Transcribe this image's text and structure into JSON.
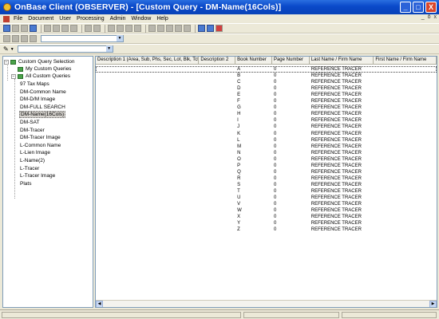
{
  "window": {
    "title": "OnBase Client (OBSERVER) - [Custom Query - DM-Name(16Cols)]"
  },
  "window_controls": [
    "_",
    "□",
    "X"
  ],
  "mdi_controls": [
    "_",
    "ō",
    "x"
  ],
  "menu": [
    "File",
    "Document",
    "User",
    "Processing",
    "Admin",
    "Window",
    "Help"
  ],
  "tree": {
    "root": "Custom Query Selection",
    "my": "My Custom Queries",
    "all": "All Custom Queries",
    "items": [
      "97 Tax Maps",
      "DM-Common Name",
      "DM-D/M Image",
      "DM-FULL SEARCH",
      "DM-Name(16Cols)",
      "DM-SAT",
      "DM-Tracer",
      "DM-Tracer Image",
      "L-Common Name",
      "L-Lien Image",
      "L-Name(2)",
      "L-Tracer",
      "L-Tracer Image",
      "Plats"
    ],
    "selected_index": 4
  },
  "grid": {
    "columns": [
      "Description 1 (Area, Sub, Phs, Sec, Lot, Blk, Tct)",
      "Description 2",
      "Book Number",
      "Page Number",
      "Last Name / Firm Name",
      "First Name / Firm Name"
    ],
    "rows": [
      [
        "",
        "",
        "A",
        "0",
        "REFERENCE TRACER",
        ""
      ],
      [
        "",
        "",
        "B",
        "0",
        "REFERENCE TRACER",
        ""
      ],
      [
        "",
        "",
        "C",
        "0",
        "REFERENCE TRACER",
        ""
      ],
      [
        "",
        "",
        "D",
        "0",
        "REFERENCE TRACER",
        ""
      ],
      [
        "",
        "",
        "E",
        "0",
        "REFERENCE TRACER",
        ""
      ],
      [
        "",
        "",
        "F",
        "0",
        "REFERENCE TRACER",
        ""
      ],
      [
        "",
        "",
        "G",
        "0",
        "REFERENCE TRACER",
        ""
      ],
      [
        "",
        "",
        "H",
        "0",
        "REFERENCE TRACER",
        ""
      ],
      [
        "",
        "",
        "I",
        "0",
        "REFERENCE TRACER",
        ""
      ],
      [
        "",
        "",
        "J",
        "0",
        "REFERENCE TRACER",
        ""
      ],
      [
        "",
        "",
        "K",
        "0",
        "REFERENCE TRACER",
        ""
      ],
      [
        "",
        "",
        "L",
        "0",
        "REFERENCE TRACER",
        ""
      ],
      [
        "",
        "",
        "M",
        "0",
        "REFERENCE TRACER",
        ""
      ],
      [
        "",
        "",
        "N",
        "0",
        "REFERENCE TRACER",
        ""
      ],
      [
        "",
        "",
        "O",
        "0",
        "REFERENCE TRACER",
        ""
      ],
      [
        "",
        "",
        "P",
        "0",
        "REFERENCE TRACER",
        ""
      ],
      [
        "",
        "",
        "Q",
        "0",
        "REFERENCE TRACER",
        ""
      ],
      [
        "",
        "",
        "R",
        "0",
        "REFERENCE TRACER",
        ""
      ],
      [
        "",
        "",
        "S",
        "0",
        "REFERENCE TRACER",
        ""
      ],
      [
        "",
        "",
        "T",
        "0",
        "REFERENCE TRACER",
        ""
      ],
      [
        "",
        "",
        "U",
        "0",
        "REFERENCE TRACER",
        ""
      ],
      [
        "",
        "",
        "V",
        "0",
        "REFERENCE TRACER",
        ""
      ],
      [
        "",
        "",
        "W",
        "0",
        "REFERENCE TRACER",
        ""
      ],
      [
        "",
        "",
        "X",
        "0",
        "REFERENCE TRACER",
        ""
      ],
      [
        "",
        "",
        "Y",
        "0",
        "REFERENCE TRACER",
        ""
      ],
      [
        "",
        "",
        "Z",
        "0",
        "REFERENCE TRACER",
        ""
      ]
    ]
  },
  "colors": {
    "titlebar": "#0a49c9",
    "selection": "#d6d3ce",
    "folder": "#4aa34a"
  },
  "icons": [
    "app-icon",
    "menu-doc-icon",
    "pencil-icon",
    "scroll-left-icon",
    "scroll-right-icon"
  ]
}
